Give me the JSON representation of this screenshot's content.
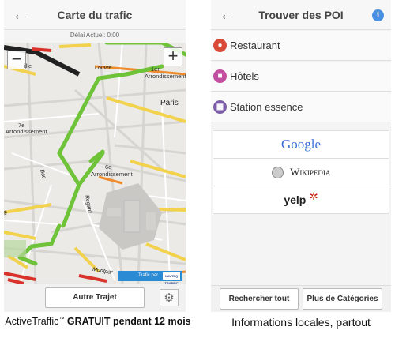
{
  "left_screen": {
    "title": "Carte du trafic",
    "delay": "Délai Actuel: 0:00",
    "map": {
      "labels": {
        "louvre": "Louvre",
        "ille": "ille",
        "arr1": "1er",
        "arr1b": "Arrondissement",
        "paris": "Paris",
        "arr7": "7e",
        "arr7b": "Arrondissement",
        "arr6": "6e",
        "arr6b": "Arrondissement",
        "arr_top": "Arrondis",
        "bac": "Bac",
        "regard": "Regard",
        "rue": "ne",
        "monp": "Montpar"
      },
      "traffic_badge": "Trafic par",
      "traffic_logo": "NAVTEQ TRAFFIC"
    },
    "buttons": {
      "other_route": "Autre Trajet"
    },
    "icons": {
      "back": "back-arrow-icon",
      "settings": "gear-icon",
      "zoom_in": "plus-icon",
      "zoom_out": "minus-icon"
    }
  },
  "right_screen": {
    "title": "Trouver des POI",
    "poi_items": [
      {
        "label": "Restaurant",
        "icon": "restaurant-icon",
        "color": "#d94a38"
      },
      {
        "label": "Hôtels",
        "icon": "hotel-icon",
        "color": "#c24f9f"
      },
      {
        "label": "Station essence",
        "icon": "gas-station-icon",
        "color": "#7b5ea7"
      }
    ],
    "search_providers": [
      "Google",
      "Wikipedia",
      "yelp"
    ],
    "buttons": {
      "search_all": "Rechercher tout",
      "more_categories": "Plus de Catégories"
    },
    "icons": {
      "back": "back-arrow-icon",
      "info": "info-icon"
    }
  },
  "captions": {
    "left_a": "ActiveTraffic",
    "left_tm": "™",
    "left_b": " GRATUIT pendant 12 mois",
    "right": "Informations locales, partout"
  }
}
